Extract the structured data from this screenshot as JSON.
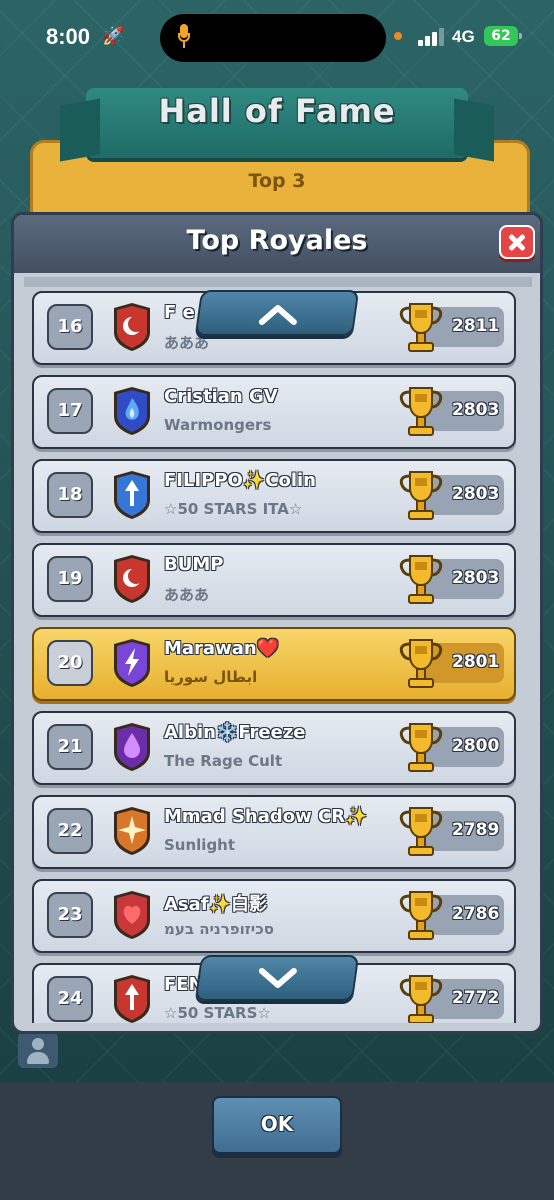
{
  "status_bar": {
    "time": "8:00",
    "network": "4G",
    "battery": "62"
  },
  "background": {
    "title": "Hall of Fame",
    "subtitle": "Top 3"
  },
  "modal": {
    "title": "Top Royales"
  },
  "rows": [
    {
      "rank": "16",
      "name": "F e",
      "clan": "あああ",
      "trophies": "2811",
      "badge_color": "#c7372f",
      "badge_symbol": "crescent",
      "highlight": false
    },
    {
      "rank": "17",
      "name": "Cristian GV",
      "clan": "Warmongers",
      "trophies": "2803",
      "badge_color": "#2f4cc4",
      "badge_symbol": "flame",
      "highlight": false
    },
    {
      "rank": "18",
      "name": "FILIPPO✨Colin",
      "clan": "☆50 STARS ITA☆",
      "trophies": "2803",
      "badge_color": "#3576d6",
      "badge_symbol": "arrow",
      "highlight": false
    },
    {
      "rank": "19",
      "name": "BUMP",
      "clan": "あああ",
      "trophies": "2803",
      "badge_color": "#c7372f",
      "badge_symbol": "crescent",
      "highlight": false
    },
    {
      "rank": "20",
      "name": "Marawan❤️",
      "clan": "ابطال سوريا",
      "trophies": "2801",
      "badge_color": "#7a46d8",
      "badge_symbol": "lightning",
      "highlight": true
    },
    {
      "rank": "21",
      "name": "Albin❄️Freeze",
      "clan": "The Rage Cult",
      "trophies": "2800",
      "badge_color": "#6a2fa8",
      "badge_symbol": "drop",
      "highlight": false
    },
    {
      "rank": "22",
      "name": "Mmad Shadow CR✨",
      "clan": "Sunlight",
      "trophies": "2789",
      "badge_color": "#d8762a",
      "badge_symbol": "star",
      "highlight": false
    },
    {
      "rank": "23",
      "name": "Asaf✨白影",
      "clan": "סכיזופרניה בעמ",
      "trophies": "2786",
      "badge_color": "#c8373a",
      "badge_symbol": "heart",
      "highlight": false
    },
    {
      "rank": "24",
      "name": "FENC",
      "clan": "☆50 STARS☆",
      "trophies": "2772",
      "badge_color": "#c7372f",
      "badge_symbol": "arrow",
      "highlight": false
    }
  ],
  "buttons": {
    "ok_label": "OK"
  },
  "icons": {
    "scroll_up": "chevron-up-icon",
    "scroll_down": "chevron-down-icon",
    "close": "close-icon",
    "trophy": "trophy-icon"
  }
}
